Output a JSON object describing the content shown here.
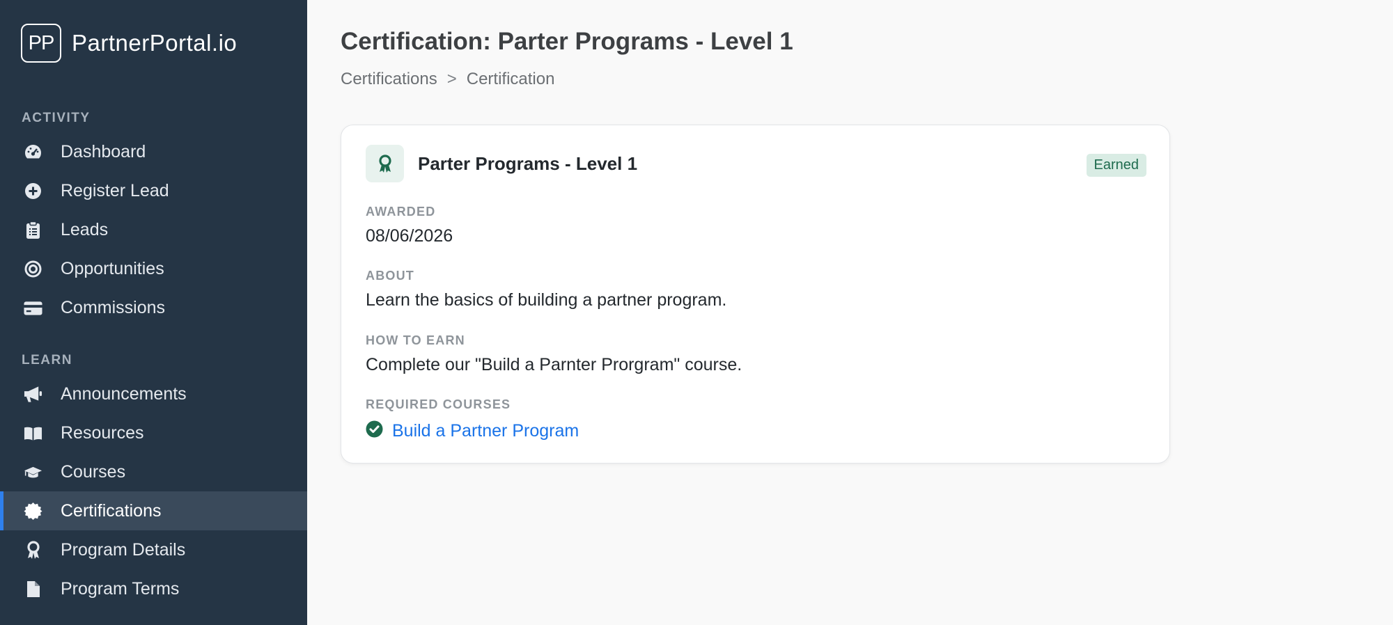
{
  "brand": {
    "logo_text": "PP",
    "name": "PartnerPortal.io"
  },
  "sidebar": {
    "sections": [
      {
        "label": "ACTIVITY",
        "items": [
          {
            "label": "Dashboard",
            "icon": "dashboard-gauge-icon"
          },
          {
            "label": "Register Lead",
            "icon": "plus-circle-icon"
          },
          {
            "label": "Leads",
            "icon": "clipboard-icon"
          },
          {
            "label": "Opportunities",
            "icon": "target-icon"
          },
          {
            "label": "Commissions",
            "icon": "credit-card-icon"
          }
        ]
      },
      {
        "label": "LEARN",
        "items": [
          {
            "label": "Announcements",
            "icon": "megaphone-icon"
          },
          {
            "label": "Resources",
            "icon": "book-icon"
          },
          {
            "label": "Courses",
            "icon": "graduation-cap-icon"
          },
          {
            "label": "Certifications",
            "icon": "certificate-icon",
            "active": true
          },
          {
            "label": "Program Details",
            "icon": "award-ribbon-icon"
          },
          {
            "label": "Program Terms",
            "icon": "document-icon"
          }
        ]
      }
    ]
  },
  "page": {
    "title": "Certification: Parter Programs - Level 1",
    "breadcrumb": [
      "Certifications",
      ">",
      "Certification"
    ]
  },
  "card": {
    "title": "Parter Programs - Level 1",
    "icon": "award-ribbon-icon",
    "badge": "Earned",
    "fields": {
      "awarded_label": "AWARDED",
      "awarded_value": "08/06/2026",
      "about_label": "ABOUT",
      "about_value": "Learn the basics of building a partner program.",
      "how_label": "HOW TO EARN",
      "how_value": "Complete our \"Build a Parnter Prorgram\" course.",
      "required_label": "REQUIRED COURSES"
    },
    "required_courses": [
      {
        "name": "Build a Partner Program",
        "completed": true
      }
    ]
  },
  "colors": {
    "sidebar_bg": "#253545",
    "active_item_bg": "#3a4a5b",
    "accent": "#2f80ed",
    "badge_bg": "#d9ece4",
    "badge_text": "#1e6b4e",
    "link": "#1a73e8",
    "success": "#1e6b4e"
  }
}
